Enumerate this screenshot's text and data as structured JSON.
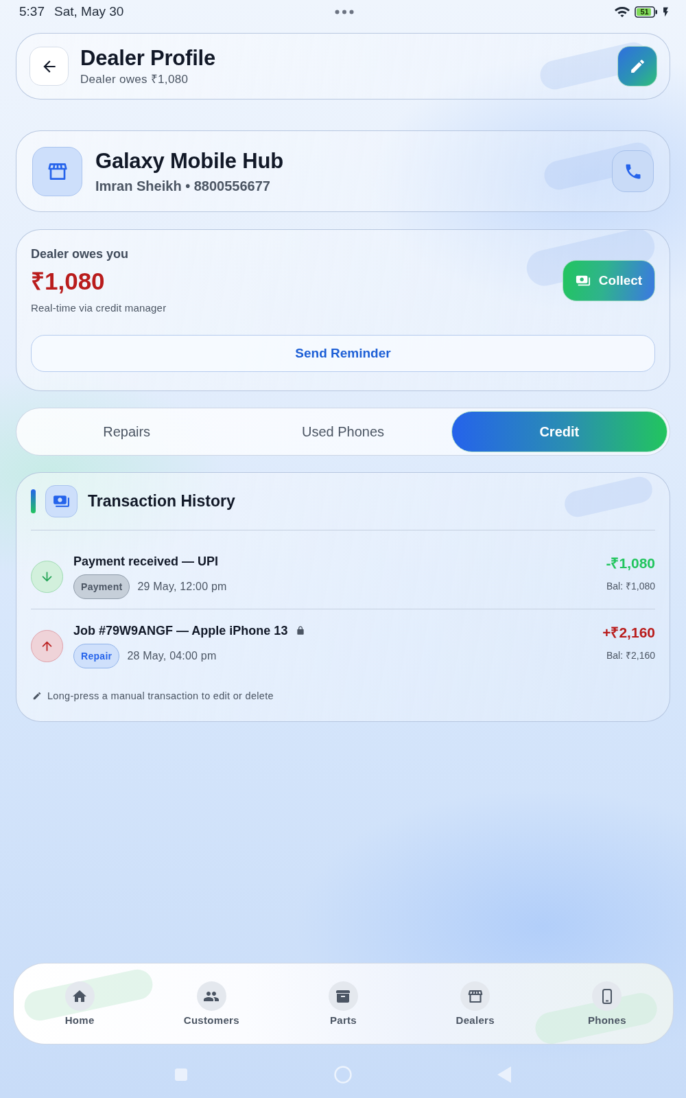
{
  "status_bar": {
    "time": "5:37",
    "date": "Sat, May 30",
    "battery": "51"
  },
  "header": {
    "title": "Dealer Profile",
    "subtitle": "Dealer owes ₹1,080"
  },
  "dealer": {
    "name": "Galaxy Mobile Hub",
    "contact": "Imran Sheikh • 8800556677"
  },
  "balance": {
    "label": "Dealer owes you",
    "amount": "₹1,080",
    "note": "Real-time via credit manager",
    "collect_button": "Collect",
    "reminder_button": "Send Reminder"
  },
  "tabs": [
    {
      "label": "Repairs",
      "selected": false
    },
    {
      "label": "Used Phones",
      "selected": false
    },
    {
      "label": "Credit",
      "selected": true
    }
  ],
  "transactions": {
    "title": "Transaction History",
    "items": [
      {
        "kind": "payment",
        "title": "Payment received — UPI",
        "locked": false,
        "tag": "Payment",
        "date": "29 May, 12:00 pm",
        "amount": "-₹1,080",
        "balance": "Bal: ₹1,080"
      },
      {
        "kind": "repair",
        "title": "Job #79W9ANGF — Apple iPhone 13",
        "locked": true,
        "tag": "Repair",
        "date": "28 May, 04:00 pm",
        "amount": "+₹2,160",
        "balance": "Bal: ₹2,160"
      }
    ],
    "hint": "Long-press a manual transaction to edit or delete"
  },
  "bottom_nav": [
    {
      "kind": "home",
      "label": "Home",
      "selected": false
    },
    {
      "kind": "customers",
      "label": "Customers",
      "selected": false
    },
    {
      "kind": "parts",
      "label": "Parts",
      "selected": false
    },
    {
      "kind": "dealers",
      "label": "Dealers",
      "selected": false
    },
    {
      "kind": "phones",
      "label": "Phones",
      "selected": false
    }
  ]
}
